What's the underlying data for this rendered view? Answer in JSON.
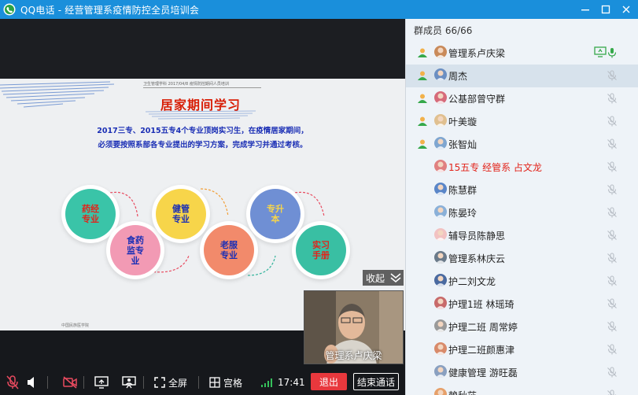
{
  "window": {
    "title": "QQ电话 - 经营管理系疫情防控全员培训会"
  },
  "slide": {
    "top_label": "卫生管理学科    2017/04/8    疫情防控期间人员培训",
    "title": "居家期间学习",
    "line1": "2017三专、2015五专4个专业顶岗实习生，在疫情居家期间，",
    "line2": "必须要按照系部各专业提出的学习方案，完成学习并通过考核。",
    "circles": [
      {
        "label": "药经\n专业",
        "bg": "#3ac4a8",
        "color": "#e2231a"
      },
      {
        "label": "食药\n监专\n业",
        "bg": "#f29ab4",
        "color": "#1b2fb5"
      },
      {
        "label": "健管\n专业",
        "bg": "#f7d54a",
        "color": "#1b2fb5"
      },
      {
        "label": "老服\n专业",
        "bg": "#f28a6b",
        "color": "#1b2fb5"
      },
      {
        "label": "专升\n本",
        "bg": "#6f8fd4",
        "color": "#f7d54a"
      },
      {
        "label": "实习\n手册",
        "bg": "#39bfa3",
        "color": "#e2231a"
      }
    ],
    "credit": "中国民族医学院"
  },
  "collapse_label": "收起",
  "video": {
    "name": "管理系卢庆梁"
  },
  "toolbar": {
    "fullscreen_label": "全屏",
    "grid_label": "宫格",
    "time": "17:41",
    "exit_label": "退出",
    "end_label": "结束通话"
  },
  "members_panel": {
    "header": "群成员 66/66",
    "members": [
      {
        "name": "管理系卢庆梁",
        "speaker": true,
        "screen": true,
        "red": false
      },
      {
        "name": "周杰",
        "speaker": true,
        "screen": false,
        "red": false
      },
      {
        "name": "公基部曾守群",
        "speaker": true,
        "screen": false,
        "red": false
      },
      {
        "name": "叶美璇",
        "speaker": true,
        "screen": false,
        "red": false
      },
      {
        "name": "张智灿",
        "speaker": true,
        "screen": false,
        "red": false
      },
      {
        "name": "15五专 经管系 占文龙",
        "speaker": false,
        "screen": false,
        "red": true
      },
      {
        "name": "陈慧群",
        "speaker": false,
        "screen": false,
        "red": false
      },
      {
        "name": "陈晏玲",
        "speaker": false,
        "screen": false,
        "red": false
      },
      {
        "name": "辅导员陈静思",
        "speaker": false,
        "screen": false,
        "red": false
      },
      {
        "name": "管理系林庆云",
        "speaker": false,
        "screen": false,
        "red": false
      },
      {
        "name": "护二刘文龙",
        "speaker": false,
        "screen": false,
        "red": false
      },
      {
        "name": "护理1班 林瑶琦",
        "speaker": false,
        "screen": false,
        "red": false
      },
      {
        "name": "护理二班 周常婷",
        "speaker": false,
        "screen": false,
        "red": false
      },
      {
        "name": "护理二班颜惠津",
        "speaker": false,
        "screen": false,
        "red": false
      },
      {
        "name": "健康管理  游旺磊",
        "speaker": false,
        "screen": false,
        "red": false
      },
      {
        "name": "賴秋莎",
        "speaker": false,
        "screen": false,
        "red": false
      }
    ]
  },
  "colors": {
    "titlebar": "#1a8fdb",
    "exit": "#e8383d",
    "selected_row": "#d7e2ec"
  }
}
